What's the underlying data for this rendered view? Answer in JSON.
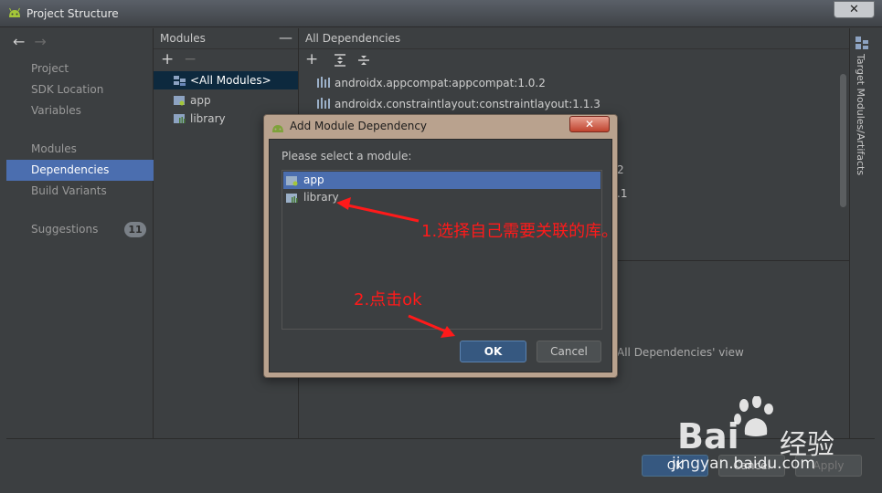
{
  "window": {
    "title": "Project Structure",
    "close_label": "✕"
  },
  "sidebar": {
    "items": [
      {
        "label": "Project",
        "selected": false
      },
      {
        "label": "SDK Location",
        "selected": false
      },
      {
        "label": "Variables",
        "selected": false
      },
      {
        "label": "Modules",
        "selected": false
      },
      {
        "label": "Dependencies",
        "selected": true
      },
      {
        "label": "Build Variants",
        "selected": false
      },
      {
        "label": "Suggestions",
        "selected": false,
        "badge": "11"
      }
    ]
  },
  "modules_pane": {
    "header": "Modules",
    "rows": [
      {
        "label": "<All Modules>",
        "icon": "all-modules-icon",
        "selected": true
      },
      {
        "label": "app",
        "icon": "app-module-icon",
        "selected": false
      },
      {
        "label": "library",
        "icon": "library-module-icon",
        "selected": false
      }
    ]
  },
  "dependencies_pane": {
    "header": "All Dependencies",
    "rows": [
      {
        "label": "androidx.appcompat:appcompat:1.0.2"
      },
      {
        "label": "androidx.constraintlayout:constraintlayout:1.1.3"
      },
      {
        "label": "2"
      },
      {
        "label": ".1"
      }
    ],
    "hint": "All Dependencies' view"
  },
  "right_strip": {
    "label": "Target Modules/Artifacts"
  },
  "bottom_bar": {
    "ok": "OK",
    "cancel": "Cancel",
    "apply": "Apply"
  },
  "dialog": {
    "title": "Add Module Dependency",
    "close_label": "✕",
    "prompt": "Please select a module:",
    "modules": [
      {
        "label": "app",
        "selected": true
      },
      {
        "label": "library",
        "selected": false
      }
    ],
    "ok": "OK",
    "cancel": "Cancel"
  },
  "annotations": {
    "step1": "1.选择自己需要关联的库。",
    "step2": "2.点击ok",
    "color": "#ff1a1a"
  },
  "watermark": {
    "brand": "Bai",
    "brand_cn": "经验",
    "url": "jingyan.baidu.com"
  },
  "colors": {
    "selection_blue": "#4b6eaf",
    "primary_button": "#365880",
    "window_bg": "#3c3f41",
    "dialog_frame": "#b9a28e"
  }
}
